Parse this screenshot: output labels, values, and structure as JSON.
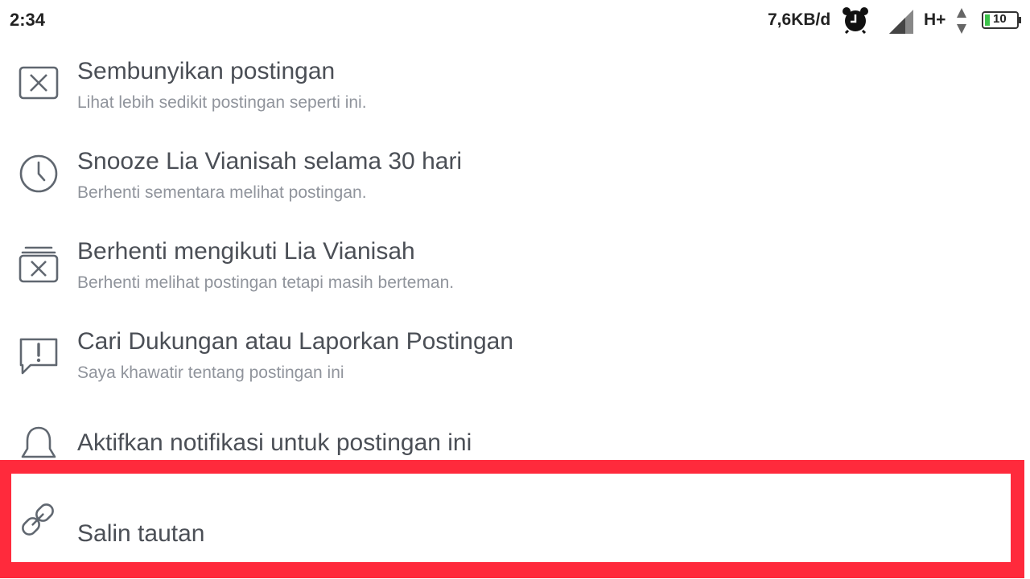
{
  "status_bar": {
    "time": "2:34",
    "speed": "7,6KB/d",
    "network": "H+",
    "battery": "10",
    "icons": [
      "alarm-clock-icon",
      "signal-icon",
      "data-arrows-icon",
      "battery-icon"
    ]
  },
  "menu": {
    "items": [
      {
        "title": "Sembunyikan postingan",
        "subtitle": "Lihat lebih sedikit postingan seperti ini.",
        "icon": "hide-x-box-icon"
      },
      {
        "title": "Snooze Lia Vianisah selama 30 hari",
        "subtitle": "Berhenti sementara melihat postingan.",
        "icon": "clock-icon"
      },
      {
        "title": "Berhenti mengikuti Lia Vianisah",
        "subtitle": "Berhenti melihat postingan tetapi masih berteman.",
        "icon": "unfollow-x-stack-icon"
      },
      {
        "title": "Cari Dukungan atau Laporkan Postingan",
        "subtitle": "Saya khawatir tentang postingan ini",
        "icon": "report-exclamation-icon"
      },
      {
        "title": "Aktifkan notifikasi untuk postingan ini",
        "subtitle": "",
        "icon": "bell-icon"
      },
      {
        "title": "Salin tautan",
        "subtitle": "",
        "icon": "link-icon"
      }
    ]
  },
  "colors": {
    "highlight": "#ff2a3c",
    "title_text": "#4b4f56",
    "subtitle_text": "#90949c",
    "icon_stroke": "#606770"
  }
}
